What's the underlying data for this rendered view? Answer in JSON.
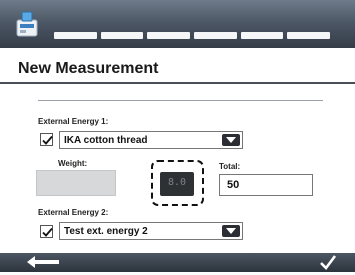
{
  "header": {
    "app_icon": "measurement-device-icon",
    "progress_segments": 6
  },
  "title": "New Measurement",
  "external_energy_1": {
    "label": "External Energy 1:",
    "checked": true,
    "selected": "IKA cotton thread"
  },
  "weight": {
    "label": "Weight:",
    "value": ""
  },
  "calc_button": {
    "text": "8.0"
  },
  "total": {
    "label": "Total:",
    "value": "50"
  },
  "external_energy_2": {
    "label": "External Energy 2:",
    "checked": true,
    "selected": "Test ext. energy 2"
  },
  "footer": {
    "back_icon": "back-arrow-icon",
    "confirm_icon": "checkmark-icon"
  },
  "colors": {
    "bar_dark": "#353d48",
    "bar_light": "#6f7b8a",
    "button_dark": "#2d3134"
  }
}
